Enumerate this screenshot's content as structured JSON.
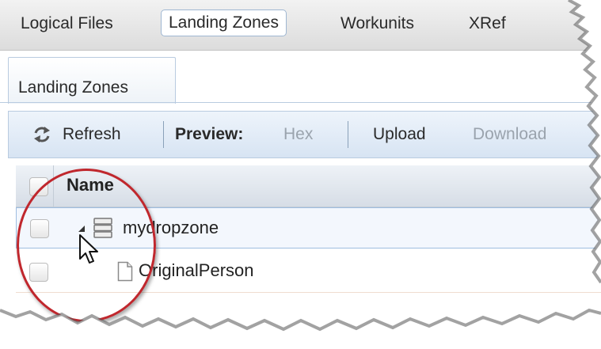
{
  "top_tabs": [
    {
      "label": "Logical Files"
    },
    {
      "label": "Landing Zones",
      "active": true
    },
    {
      "label": "Workunits"
    },
    {
      "label": "XRef"
    }
  ],
  "sub_tab": {
    "label": "Landing Zones"
  },
  "toolbar": {
    "refresh_label": "Refresh",
    "preview_label": "Preview:",
    "hex_label": "Hex",
    "upload_label": "Upload",
    "download_label": "Download"
  },
  "grid": {
    "column_name": "Name",
    "rows": [
      {
        "name": "mydropzone",
        "type": "dropzone",
        "expanded": true,
        "selected": true
      },
      {
        "name": "OriginalPerson",
        "type": "file",
        "expanded": false,
        "selected": false
      }
    ]
  },
  "colors": {
    "accent_blue": "#9ebde0",
    "annotation_red": "#c0272d",
    "disabled_text": "#9aa3ad"
  },
  "icons": [
    "refresh-icon",
    "expand-arrow-icon",
    "database-icon",
    "file-icon",
    "mouse-cursor-icon",
    "checkbox-icon"
  ]
}
